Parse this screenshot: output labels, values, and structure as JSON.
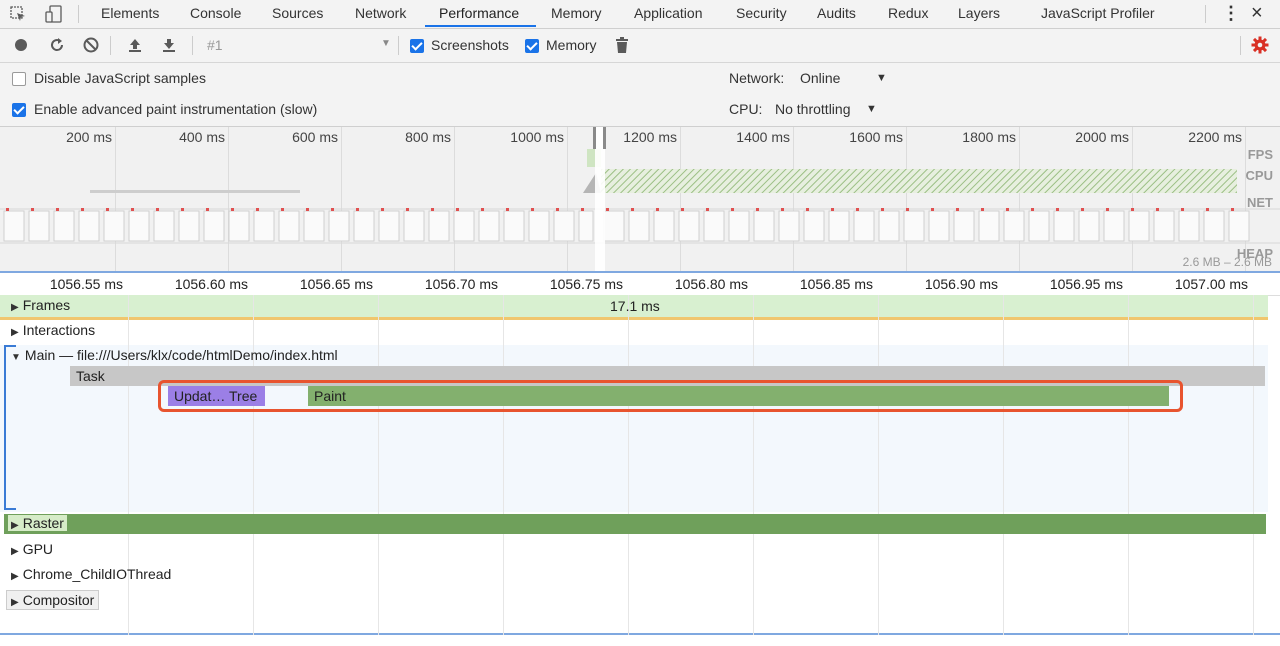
{
  "toolbar_tabs": [
    "Elements",
    "Console",
    "Sources",
    "Network",
    "Performance",
    "Memory",
    "Application",
    "Security",
    "Audits",
    "Redux",
    "Layers",
    "JavaScript Profiler"
  ],
  "toolbar": {
    "more_icon": "⋮",
    "close_icon": "×"
  },
  "controls": {
    "profile_select": "#1",
    "screenshots_label": "Screenshots",
    "memory_label": "Memory"
  },
  "settings": {
    "disable_js_samples": "Disable JavaScript samples",
    "enable_paint": "Enable advanced paint instrumentation (slow)",
    "network_label": "Network:",
    "network_value": "Online",
    "cpu_label": "CPU:",
    "cpu_value": "No throttling"
  },
  "overview": {
    "ticks": [
      "200 ms",
      "400 ms",
      "600 ms",
      "800 ms",
      "1000 ms",
      "1200 ms",
      "1400 ms",
      "1600 ms",
      "1800 ms",
      "2000 ms",
      "2200 ms"
    ],
    "tracks": {
      "fps": "FPS",
      "cpu": "CPU",
      "net": "NET",
      "heap": "HEAP"
    },
    "heap_range": "2.6 MB – 2.6 MB"
  },
  "ruler_ticks": [
    "1056.55 ms",
    "1056.60 ms",
    "1056.65 ms",
    "1056.70 ms",
    "1056.75 ms",
    "1056.80 ms",
    "1056.85 ms",
    "1056.90 ms",
    "1056.95 ms",
    "1057.00 ms"
  ],
  "tracks": {
    "frames": "Frames",
    "frame_duration": "17.1 ms",
    "interactions": "Interactions",
    "main": "Main — file:///Users/klx/code/htmlDemo/index.html",
    "task": "Task",
    "update_tree": "Updat… Tree",
    "paint": "Paint",
    "raster": "Raster",
    "gpu": "GPU",
    "io_thread": "Chrome_ChildIOThread",
    "compositor": "Compositor"
  },
  "colors": {
    "accent": "#1a73e8",
    "paint": "#83b06e",
    "update_tree": "#9b7fe6",
    "highlight": "#e8542f",
    "settings_gear": "#d93025"
  }
}
